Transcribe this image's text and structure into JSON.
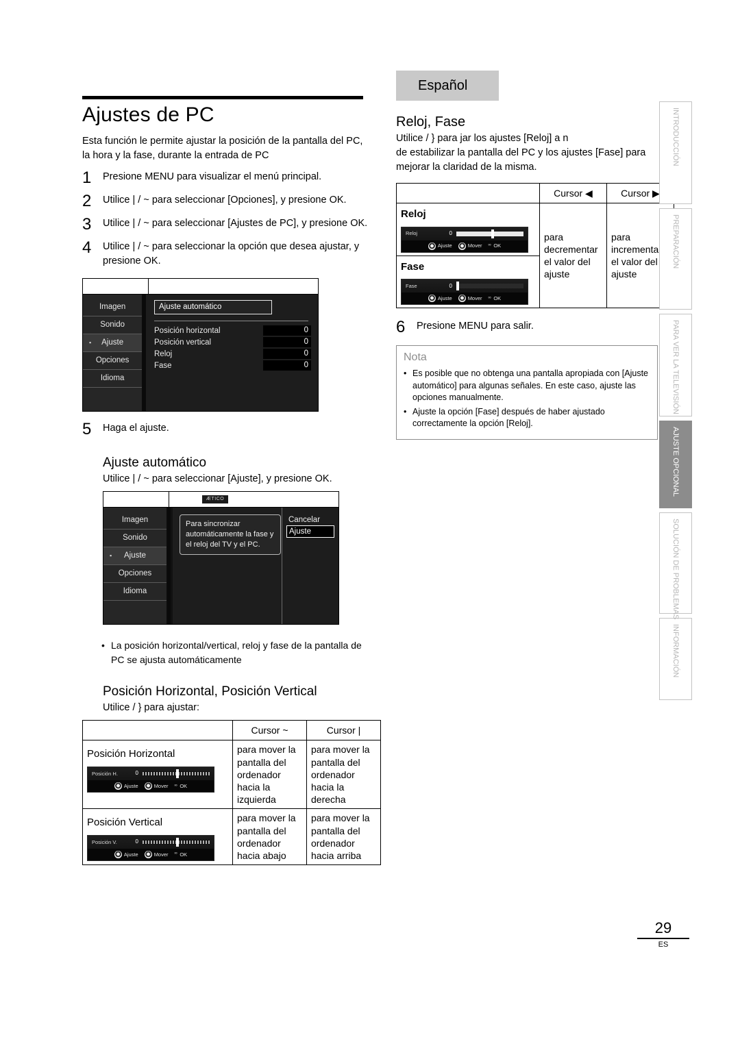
{
  "language_chip": "Español",
  "page": {
    "number": "29",
    "locale": "ES"
  },
  "left": {
    "title": "Ajustes de PC",
    "intro_line1": "Esta función le permite ajustar la posición de la pantalla del PC,",
    "intro_line2": "la hora y la fase, durante la entrada de PC",
    "steps": [
      {
        "num": "1",
        "text": "Presione MENU para visualizar el menú principal."
      },
      {
        "num": "2",
        "text": "Utilice | / ~ para seleccionar [Opciones], y presione OK."
      },
      {
        "num": "3",
        "text": "Utilice | / ~ para seleccionar [Ajustes de PC], y presione OK."
      },
      {
        "num": "4",
        "text": "Utilice | / ~ para seleccionar la opción que desea ajustar, y presione OK."
      },
      {
        "num": "5",
        "text": "Haga el ajuste."
      }
    ],
    "menu1": {
      "items": [
        {
          "label": "Imagen",
          "selected": false
        },
        {
          "label": "Sonido",
          "selected": false
        },
        {
          "label": "Ajuste",
          "selected": true
        },
        {
          "label": "Opciones",
          "selected": false
        },
        {
          "label": "Idioma",
          "selected": false
        }
      ],
      "auto_button": "Ajuste automático",
      "options": [
        {
          "label": "Posición horizontal",
          "value": "0"
        },
        {
          "label": "Posición vertical",
          "value": "0"
        },
        {
          "label": "Reloj",
          "value": "0"
        },
        {
          "label": "Fase",
          "value": "0"
        }
      ]
    },
    "auto_heading": "Ajuste automático",
    "auto_sub": "Utilice | / ~ para seleccionar [Ajuste], y presione OK.",
    "menu2": {
      "tab_label": "ÆTICO",
      "items": [
        {
          "label": "Imagen",
          "selected": false
        },
        {
          "label": "Sonido",
          "selected": false
        },
        {
          "label": "Ajuste",
          "selected": true
        },
        {
          "label": "Opciones",
          "selected": false
        },
        {
          "label": "Idioma",
          "selected": false
        }
      ],
      "dialog_text": "Para sincronizar automáticamente la fase y el reloj del TV y el PC.",
      "choices": [
        {
          "label": "Cancelar",
          "selected": false
        },
        {
          "label": "Ajuste",
          "selected": true
        }
      ]
    },
    "auto_bullet": "La posición horizontal/vertical, reloj y fase de la pantalla de PC se ajusta automáticamente",
    "pos_heading": "Posición Horizontal, Posición Vertical",
    "pos_sub": "Utilice  / } para ajustar:",
    "pos_table": {
      "headers": [
        "",
        "Cursor  ~",
        "Cursor  |"
      ],
      "rows": [
        {
          "name": "Posición Horizontal",
          "osd": {
            "name": "Posición H.",
            "value": "0"
          },
          "left_desc": "para mover la pantalla del ordenador hacia la izquierda",
          "right_desc": "para mover la pantalla del ordenador hacia la derecha"
        },
        {
          "name": "Posición Vertical",
          "osd": {
            "name": "Posición V.",
            "value": "0"
          },
          "left_desc": "para mover la pantalla del ordenador hacia abajo",
          "right_desc": "para mover la pantalla del ordenador hacia arriba"
        }
      ]
    }
  },
  "right": {
    "heading": "Reloj, Fase",
    "para_line1": "Utilice  / }  para  jar los ajustes [Reloj] a  n",
    "para_line2": "de estabilizar la pantalla del PC y los ajustes [Fase] para",
    "para_line3": "mejorar la claridad de la misma.",
    "clock_table": {
      "headers": [
        "",
        "Cursor ◀",
        "Cursor ▶"
      ],
      "rows": [
        {
          "name": "Reloj",
          "osd": {
            "name": "Reloj",
            "value": "0"
          }
        },
        {
          "name": "Fase",
          "osd": {
            "name": "Fase",
            "value": "0"
          }
        }
      ],
      "left_desc": "para decrementar el valor del ajuste",
      "right_desc": "para incrementar el valor del ajuste"
    },
    "step6": {
      "num": "6",
      "text": "Presione MENU para salir."
    },
    "nota": {
      "title": "Nota",
      "bullets": [
        "Es posible que no obtenga una pantalla apropiada con [Ajuste automático] para algunas señales. En este caso, ajuste las opciones manualmente.",
        "Ajuste la opción [Fase] después de haber ajustado correctamente la opción [Reloj]."
      ]
    }
  },
  "osd_controls": {
    "adjust": "Ajuste",
    "move": "Mover",
    "ok": "OK"
  },
  "side_tabs": [
    {
      "label": "INTRODUCCIÓN",
      "active": false
    },
    {
      "label": "PREPARACIÓN",
      "active": false
    },
    {
      "label": "PARA VER LA TELEVISIÓN",
      "active": false
    },
    {
      "label": "AJUSTE OPCIONAL",
      "active": true
    },
    {
      "label": "SOLUCIÓN DE PROBLEMAS",
      "active": false
    },
    {
      "label": "INFORMACIÓN",
      "active": false
    }
  ]
}
